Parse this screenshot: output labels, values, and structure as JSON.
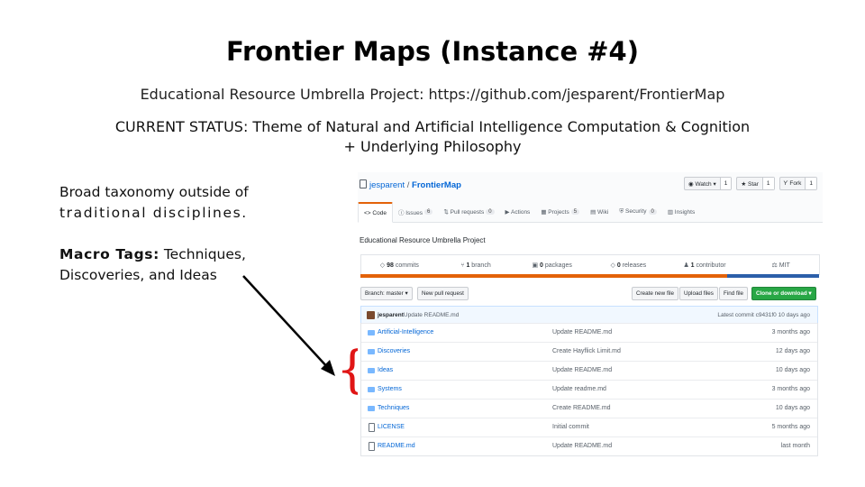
{
  "slide": {
    "title": "Frontier Maps (Instance #4)",
    "subtitle": "Educational Resource Umbrella Project:  https://github.com/jesparent/FrontierMap",
    "status": "CURRENT STATUS: Theme of Natural and Artificial Intelligence Computation & Cognition + Underlying Philosophy",
    "left_line1": "Broad taxonomy outside of",
    "left_line2": "traditional disciplines.",
    "macro_label": "Macro Tags:",
    "macro_text1": " Techniques,",
    "macro_text2": "Discoveries, and Ideas",
    "brace_char": "{",
    "accent_color": "#e01515"
  },
  "github": {
    "owner": "jesparent",
    "sep": " / ",
    "repo": "FrontierMap",
    "actions": [
      {
        "label": "◉ Watch ▾",
        "count": "1"
      },
      {
        "label": "★ Star",
        "count": "1"
      },
      {
        "label": "Ƴ Fork",
        "count": "1"
      }
    ],
    "tabs": [
      {
        "label": "<> Code",
        "count": ""
      },
      {
        "label": "ⓘ Issues",
        "count": "6"
      },
      {
        "label": "⇅ Pull requests",
        "count": "0"
      },
      {
        "label": "▶ Actions",
        "count": ""
      },
      {
        "label": "▦ Projects",
        "count": "5"
      },
      {
        "label": "▤ Wiki",
        "count": ""
      },
      {
        "label": "⛨ Security",
        "count": "0"
      },
      {
        "label": "▥ Insights",
        "count": ""
      }
    ],
    "description": "Educational Resource Umbrella Project",
    "stats": [
      {
        "icon": "◇",
        "num": "98",
        "label": " commits"
      },
      {
        "icon": "⑂",
        "num": "1",
        "label": " branch"
      },
      {
        "icon": "▣",
        "num": "0",
        "label": " packages"
      },
      {
        "icon": "◇",
        "num": "0",
        "label": " releases"
      },
      {
        "icon": "♟",
        "num": "1",
        "label": " contributor"
      },
      {
        "icon": "⚖",
        "num": "",
        "label": " MIT"
      }
    ],
    "branch_button": "Branch: master ▾",
    "new_pr_button": "New pull request",
    "create_file_button": "Create new file",
    "upload_button": "Upload files",
    "find_button": "Find file",
    "clone_button": "Clone or download ▾",
    "commit_author": "jesparent",
    "commit_message": " Update README.md",
    "latest_commit": "Latest commit c9431f0 10 days ago",
    "files": [
      {
        "type": "dir",
        "name": "Artificial-Intelligence",
        "message": "Update README.md",
        "age": "3 months ago"
      },
      {
        "type": "dir",
        "name": "Discoveries",
        "message": "Create Hayflick Limit.md",
        "age": "12 days ago"
      },
      {
        "type": "dir",
        "name": "Ideas",
        "message": "Update README.md",
        "age": "10 days ago"
      },
      {
        "type": "dir",
        "name": "Systems",
        "message": "Update readme.md",
        "age": "3 months ago"
      },
      {
        "type": "dir",
        "name": "Techniques",
        "message": "Create README.md",
        "age": "10 days ago"
      },
      {
        "type": "file",
        "name": "LICENSE",
        "message": "Initial commit",
        "age": "5 months ago"
      },
      {
        "type": "file",
        "name": "README.md",
        "message": "Update README.md",
        "age": "last month"
      }
    ]
  }
}
